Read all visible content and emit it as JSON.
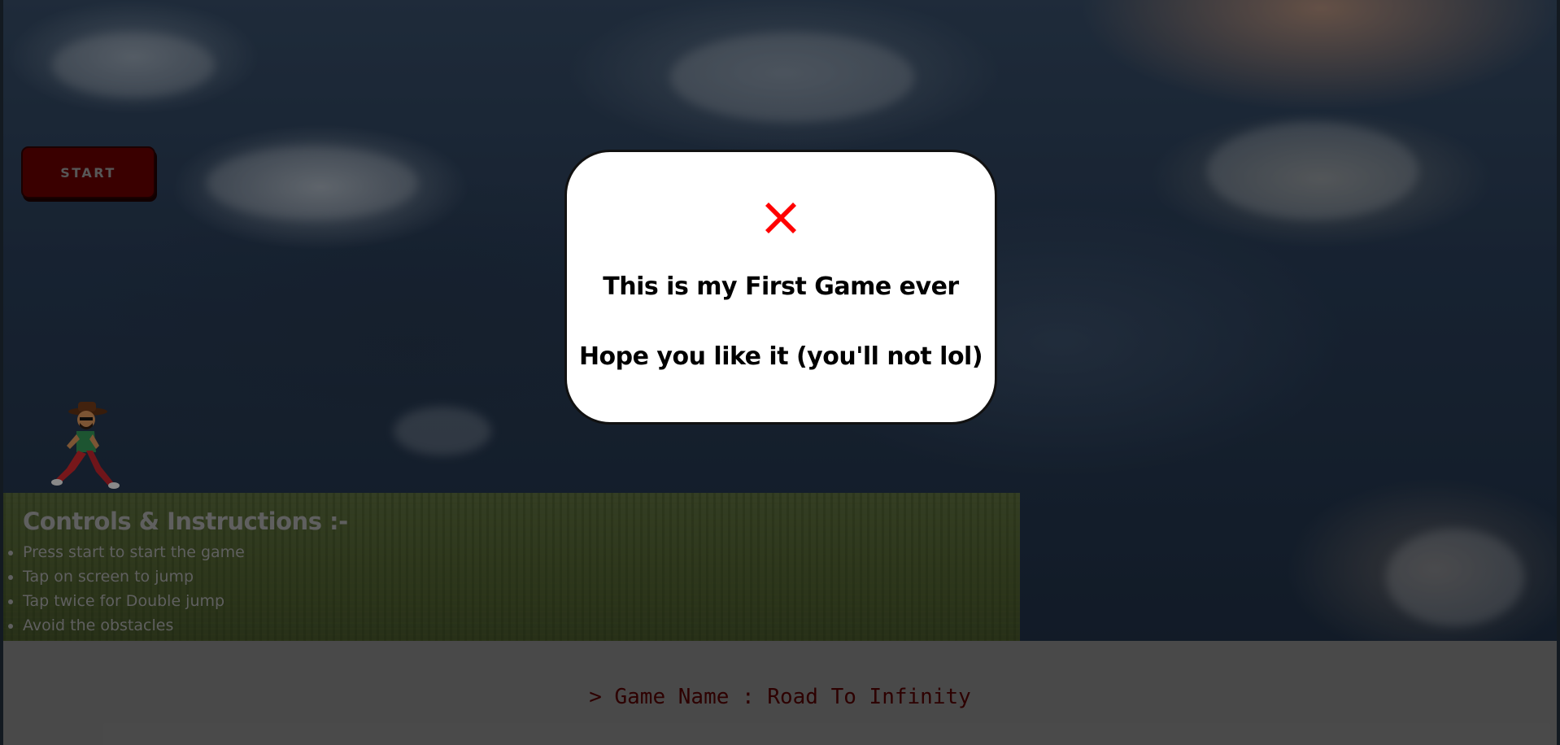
{
  "game": {
    "start_label": "START",
    "instructions": {
      "title": "Controls & Instructions :-",
      "items": [
        "Press start to start the game",
        "Tap on screen to jump",
        "Tap twice for Double jump",
        "Avoid the obstacles"
      ]
    },
    "footer_text": "> Game Name : Road To Infinity"
  },
  "modal": {
    "close_icon": "close-x-icon",
    "line1": "This is my First Game ever",
    "line2": "Hope you like it (you'll not lol)"
  },
  "colors": {
    "start_button_bg": "#5e0000",
    "footer_bg": "#777777",
    "footer_text": "#4a0000",
    "close_icon": "#ff0000",
    "modal_bg": "#ffffff"
  }
}
